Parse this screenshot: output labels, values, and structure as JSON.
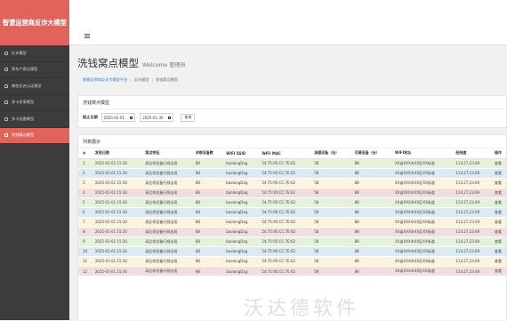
{
  "app": {
    "brand": "智慧运营商反诈大模型"
  },
  "sidebar": {
    "items": [
      {
        "label": "反诈模型",
        "active": false
      },
      {
        "label": "黑灰产窝点模型",
        "active": false
      },
      {
        "label": "哪些实名认证模型",
        "active": false
      },
      {
        "label": "多卡多家模型",
        "active": false
      },
      {
        "label": "多卡设备模型",
        "active": false
      },
      {
        "label": "洗钱窝点模型",
        "active": true
      }
    ]
  },
  "page": {
    "title": "洗钱窝点模型",
    "subtitle": "Welcome 管理员"
  },
  "breadcrumb": {
    "items": [
      "智慧运营商反诈大模型平台",
      "反诈模型",
      "洗钱窝点模型"
    ]
  },
  "filter": {
    "panel_title": "洗钱窝点模型",
    "date_label": "起止日期",
    "start_date": "2025-01-01",
    "end_date": "2025-01-30",
    "separator": "-",
    "query_label": "查询"
  },
  "list": {
    "panel_title": "列表展示",
    "columns": [
      "#",
      "发现日期",
      "窝点特征",
      "关联设备数",
      "WIFI SSID",
      "WIFI MAC",
      "流通设备（台）",
      "可疑设备（台）",
      "WIFI地址",
      "经纬度",
      "操作"
    ],
    "rows": [
      [
        "1",
        "2025-01-01 15:30",
        "高比例设备行频出现",
        "88",
        "baolongDag",
        "54:75:95:CC:7E:62",
        "58",
        "88",
        "XX省XXX市XX区XX街道",
        "114.27,23.69",
        "查看"
      ],
      [
        "2",
        "2025-01-01 15:30",
        "高比例设备行频出现",
        "88",
        "baolongDag",
        "54:75:95:CC:7E:62",
        "58",
        "88",
        "XX省XXX市XX区XX街道",
        "114.27,23.69",
        "查看"
      ],
      [
        "3",
        "2025-01-01 15:30",
        "高比例设备行频出现",
        "88",
        "baolongDag",
        "54:75:95:CC:7E:62",
        "58",
        "88",
        "XX省XXX市XX区XX街道",
        "114.27,23.69",
        "查看"
      ],
      [
        "4",
        "2025-01-01 15:30",
        "高比例设备行频出现",
        "88",
        "baolongDag",
        "54:75:95:CC:7E:62",
        "58",
        "88",
        "XX省XXX市XX区XX街道",
        "114.27,23.69",
        "查看"
      ],
      [
        "5",
        "2025-01-01 15:30",
        "高比例设备行频出现",
        "88",
        "baolongDag",
        "54:75:95:CC:7E:62",
        "58",
        "88",
        "XX省XXX市XX区XX街道",
        "114.27,23.69",
        "查看"
      ],
      [
        "6",
        "2025-01-01 15:30",
        "高比例设备行频出现",
        "88",
        "baolongDag",
        "54:75:95:CC:7E:62",
        "58",
        "88",
        "XX省XXX市XX区XX街道",
        "114.27,23.69",
        "查看"
      ],
      [
        "7",
        "2025-01-01 15:30",
        "高比例设备行频出现",
        "88",
        "baolongDag",
        "54:75:95:CC:7E:62",
        "58",
        "88",
        "XX省XXX市XX区XX街道",
        "114.27,23.69",
        "查看"
      ],
      [
        "8",
        "2025-01-01 15:30",
        "高比例设备行频出现",
        "88",
        "baolongDag",
        "54:75:95:CC:7E:62",
        "58",
        "88",
        "XX省XXX市XX区XX街道",
        "114.27,23.69",
        "查看"
      ],
      [
        "9",
        "2025-01-01 15:30",
        "高比例设备行频出现",
        "88",
        "baolongDag",
        "54:75:95:CC:7E:62",
        "58",
        "88",
        "XX省XXX市XX区XX街道",
        "114.27,23.69",
        "查看"
      ],
      [
        "10",
        "2025-01-01 15:30",
        "高比例设备行频出现",
        "88",
        "baolongDag",
        "54:75:95:CC:7E:62",
        "58",
        "88",
        "XX省XXX市XX区XX街道",
        "114.27,23.69",
        "查看"
      ],
      [
        "11",
        "2025-01-01 15:30",
        "高比例设备行频出现",
        "88",
        "baolongDag",
        "54:75:95:CC:7E:62",
        "58",
        "88",
        "XX省XXX市XX区XX街道",
        "114.27,23.69",
        "查看"
      ],
      [
        "12",
        "2025-01-01 15:30",
        "高比例设备行频出现",
        "88",
        "baolongDag",
        "54:75:95:CC:7E:62",
        "58",
        "88",
        "XX省XXX市XX区XX街道",
        "114.27,23.69",
        "查看"
      ]
    ]
  },
  "watermark": "沃达德软件",
  "colors": {
    "brand": "#e0645c",
    "sidebar": "#3c3c3c",
    "row_green": "#e6f1dc",
    "row_blue": "#dbeaf3",
    "row_yellow": "#faf3df",
    "row_red": "#f2dede"
  }
}
